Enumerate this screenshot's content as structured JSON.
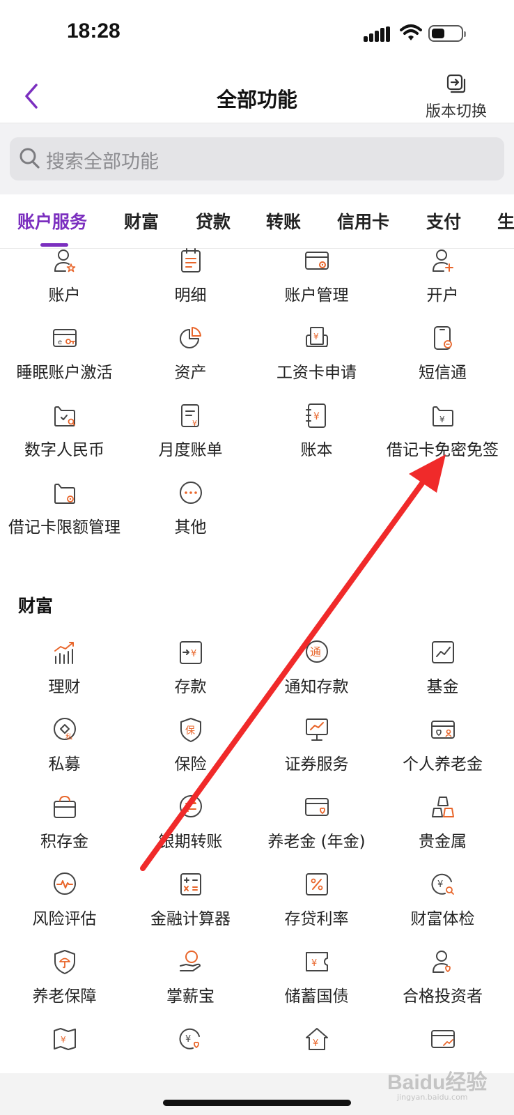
{
  "status": {
    "time": "18:28"
  },
  "header": {
    "title": "全部功能",
    "switch_label": "版本切换"
  },
  "search": {
    "placeholder": "搜索全部功能"
  },
  "tabs": [
    {
      "label": "账户服务",
      "active": true
    },
    {
      "label": "财富"
    },
    {
      "label": "贷款"
    },
    {
      "label": "转账"
    },
    {
      "label": "信用卡"
    },
    {
      "label": "支付"
    },
    {
      "label": "生"
    }
  ],
  "account_items": [
    {
      "label": "账户",
      "icon": "user-star-icon"
    },
    {
      "label": "明细",
      "icon": "list-calendar-icon"
    },
    {
      "label": "账户管理",
      "icon": "card-gear-icon"
    },
    {
      "label": "开户",
      "icon": "user-plus-icon"
    },
    {
      "label": "睡眠账户激活",
      "icon": "card-key-icon"
    },
    {
      "label": "资产",
      "icon": "pie-chart-icon"
    },
    {
      "label": "工资卡申请",
      "icon": "printer-yuan-icon"
    },
    {
      "label": "短信通",
      "icon": "phone-message-icon"
    },
    {
      "label": "数字人民币",
      "icon": "wallet-check-icon"
    },
    {
      "label": "月度账单",
      "icon": "bill-yuan-icon"
    },
    {
      "label": "账本",
      "icon": "ledger-yuan-icon"
    },
    {
      "label": "借记卡免密免签",
      "icon": "wallet-yuan-icon"
    },
    {
      "label": "借记卡限额管理",
      "icon": "wallet-gear-icon"
    },
    {
      "label": "其他",
      "icon": "more-dots-icon"
    }
  ],
  "wealth": {
    "title": "财富",
    "items": [
      {
        "label": "理财",
        "icon": "bar-trend-icon"
      },
      {
        "label": "存款",
        "icon": "deposit-yuan-icon"
      },
      {
        "label": "通知存款",
        "icon": "notice-circle-icon"
      },
      {
        "label": "基金",
        "icon": "fund-chart-icon"
      },
      {
        "label": "私募",
        "icon": "private-diamond-icon"
      },
      {
        "label": "保险",
        "icon": "insurance-shield-icon"
      },
      {
        "label": "证券服务",
        "icon": "securities-monitor-icon"
      },
      {
        "label": "个人养老金",
        "icon": "pension-card-icon"
      },
      {
        "label": "积存金",
        "icon": "gold-box-icon"
      },
      {
        "label": "银期转账",
        "icon": "transfer-circle-icon"
      },
      {
        "label": "养老金 (年金)",
        "icon": "annuity-card-icon"
      },
      {
        "label": "贵金属",
        "icon": "gold-bars-icon"
      },
      {
        "label": "风险评估",
        "icon": "risk-pulse-icon"
      },
      {
        "label": "金融计算器",
        "icon": "calculator-icon"
      },
      {
        "label": "存贷利率",
        "icon": "percent-icon"
      },
      {
        "label": "财富体检",
        "icon": "wealth-check-icon"
      },
      {
        "label": "养老保障",
        "icon": "shield-umbrella-icon"
      },
      {
        "label": "掌薪宝",
        "icon": "hand-coin-icon"
      },
      {
        "label": "储蓄国债",
        "icon": "bond-ticket-icon"
      },
      {
        "label": "合格投资者",
        "icon": "investor-user-icon"
      }
    ],
    "partial_icons": [
      "map-yuan-icon",
      "yuan-heart-icon",
      "house-yuan-icon",
      "card-trend-icon"
    ]
  },
  "watermark": {
    "brand": "Baidu经验",
    "url": "jingyan.baidu.com"
  },
  "colors": {
    "accent": "#7b2fbf",
    "icon_orange": "#e8652a",
    "arrow": "#f02a2a"
  }
}
